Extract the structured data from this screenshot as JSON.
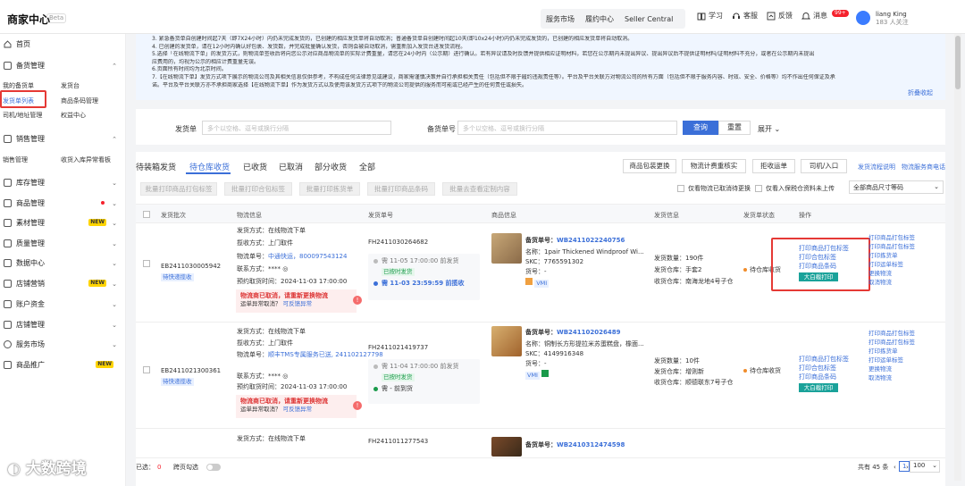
{
  "brand": {
    "title": "商家中心",
    "beta": "Beta"
  },
  "topnav": [
    "服务市场",
    "履约中心",
    "Seller Central"
  ],
  "topicons": {
    "learn": "学习",
    "service": "客服",
    "feedback": "反馈",
    "message": "消息",
    "message_badge": "99+"
  },
  "user": {
    "name": "liang King",
    "sub": "183 人关注"
  },
  "sidebar": {
    "home": "首页",
    "stock_mgmt": "备货管理",
    "sub1": [
      "我的备货单",
      "发货台",
      "发货单列表",
      "商品条码管理",
      "司机/地址管理",
      "权益中心"
    ],
    "sales_mgmt": "销售管理",
    "sub2": [
      "销售管理",
      "收货入库异常看板"
    ],
    "items": [
      "库存管理",
      "商品管理",
      "素材管理",
      "质量管理",
      "数据中心",
      "店铺营销",
      "账户资金",
      "店铺管理",
      "服务市场",
      "商品推广"
    ],
    "new_badge": "NEW"
  },
  "notice": [
    "3. 紧急备货单自创建时间起7天（即7X24小时）内仍未完成发货的，已创建的相应发货单将自动取消；普通备货单自创建时间起10天(即10x24小时)内仍未完成发货的，已创建的相应发货单将自动取消。",
    "4. 已创建的发货单，请在12小时内确认好包裹、发货数，并完成批量确认发货，否则会被自动取消，需重新加入发货台进发货流程。",
    "5.选择「在线物流下单」的发货方式，则物流单签收后将向您公示对应商品物流单的实际计费重量，请您在24小时内（公示期）进行确认。若有异议请及时反馈并提供相应证明材料，若您在公示期内未提出异议、提出异议后不提供证明材料/证明材料不充分，或者在公示期内未提出",
    "应费用的，均视为公示的相应计费重量无误。",
    "6.页面所有时间均为北京时间。",
    "7.【在线物流下单】发货方式项下展示的物流公司及其相关信息仅供参考，不构成任何法律意见或建议，商家需谨慎决策并自行承担相关责任（包括但不限于履约违规责任等）。平台及平台关联方对物流公司的所有方面（包括但不限于服务内容、时效、安全、价格等）均不作出任何保证及承",
    "诺。平台及平台关联方亦不承担商家选择【在线物流下单】作为发货方式以及使用该发货方式项下的物流公司提供的服务而可能或已经产生的任何责任或损失。"
  ],
  "collapse": "折叠收起",
  "filter": {
    "ship_label": "发货单",
    "ship_ph": "多个以空格、逗号或换行分隔",
    "stock_label": "备货单号",
    "stock_ph": "多个以空格、逗号或换行分隔",
    "query": "查询",
    "reset": "重置",
    "expand": "展开"
  },
  "tabs": [
    "待装箱发货",
    "待仓库收货",
    "已收货",
    "已取消",
    "部分收货",
    "全部"
  ],
  "actions": [
    "商品包装更换",
    "物流计费重核实",
    "拒收运单",
    "司机/入口"
  ],
  "links": [
    "发货流程说明",
    "物流服务商电话"
  ],
  "batch": [
    "批量打印商品打包标签",
    "批量打印合包标签",
    "批量打印拣货单",
    "批量打印商品条码",
    "批量去查看定制内容"
  ],
  "checks": [
    "仅看物流已取消待更换",
    "仅看入保税仓资料未上传"
  ],
  "size_select": "全部商品尺寸等码",
  "columns": [
    "发货批次",
    "物流信息",
    "发货单号",
    "商品信息",
    "发货信息",
    "发货单状态",
    "操作"
  ],
  "rows": [
    {
      "batch": "EB2411030005942",
      "batch_tag": "待快递揽收",
      "ship_way": "发货方式：在线物流下单",
      "pickup": "揽收方式：上门取件",
      "waybill_prefix": "物流单号：",
      "waybill": "中通快运，800097543124",
      "contact": "联系方式：**** ◎",
      "appt": "预约取货时间：2024-11-03 17:00:00",
      "warn_t": "物流商已取消，请重新更换物流",
      "warn_s": "运单异常取消？",
      "warn_link": "可反馈异常",
      "ship_no": "FH2411030264682",
      "t1": "需 11-05 17:00:00 前发货",
      "t1_tag": "已按时发货",
      "t2": "需 11-03 23:59:59 前揽收",
      "po": "备货单号：",
      "po_no": "WB2411022240756",
      "name": "名称：1pair Thickened Windproof Wi...",
      "skc": "SKC：7765591302",
      "kind": "货号：-",
      "tag1": "VMI",
      "qty": "发货数量：190件",
      "wh": "发货仓库：手套2",
      "recv": "收货仓库：南海龙地4号子仓",
      "status": "待仓库收货",
      "ops": [
        "打印商品打包标签",
        "打印合包标签",
        "打印商品条码"
      ],
      "op_btn": "大白截打印",
      "ops2": [
        "打印商品打包标签",
        "打印商品打包标签",
        "打印拣货单",
        "打印运单标签",
        "更换物流",
        "取消物流"
      ]
    },
    {
      "batch": "EB2411021300361",
      "batch_tag": "待快递揽收",
      "ship_way": "发货方式：在线物流下单",
      "pickup": "揽收方式：上门取件",
      "waybill_prefix": "物流单号：",
      "waybill": "顺丰TMS专属服务已送, 241102127798",
      "contact": "联系方式：**** ◎",
      "appt": "预约取货时间：2024-11-03 17:00:00",
      "warn_t": "物流商已取消，请重新更换物流",
      "warn_s": "运单异常取消？",
      "warn_link": "可反馈异常",
      "ship_no": "FH2411021419737",
      "t1": "需 11-04 17:00:00 前发货",
      "t1_tag": "已按时发货",
      "t2": "需 - 前到货",
      "po": "备货单号：",
      "po_no": "WB241102026489",
      "name": "名称：铜制长方形提拉米苏蛋糕盘，橡面...",
      "skc": "SKC：4149916348",
      "kind": "货号：-",
      "tag1": "VMI",
      "qty": "发货数量：10件",
      "wh": "发货仓库：增则新",
      "recv": "收货仓库：顺德联东7号子仓",
      "status": "待仓库收货",
      "ops": [
        "打印商品打包标签",
        "打印合包标签",
        "打印商品条码"
      ],
      "op_btn": "大白截打印",
      "ops2": [
        "打印商品打包标签",
        "打印商品打包标签",
        "打印拣货单",
        "打印运单标签",
        "更换物流",
        "取消物流"
      ]
    },
    {
      "ship_way": "发货方式：在线物流下单",
      "ship_no": "FH2411011277543",
      "po": "备货单号：",
      "po_no": "WB2410312474598"
    }
  ],
  "footer": {
    "selected": "已选：",
    "count": "0",
    "cross": "跨页勾选",
    "total": "共有 45 条",
    "page_size": "100"
  },
  "watermark": "大数跨境",
  "colors": {
    "accent": "#3b6fd8",
    "red": "#e53935",
    "teal": "#1aa29a"
  }
}
